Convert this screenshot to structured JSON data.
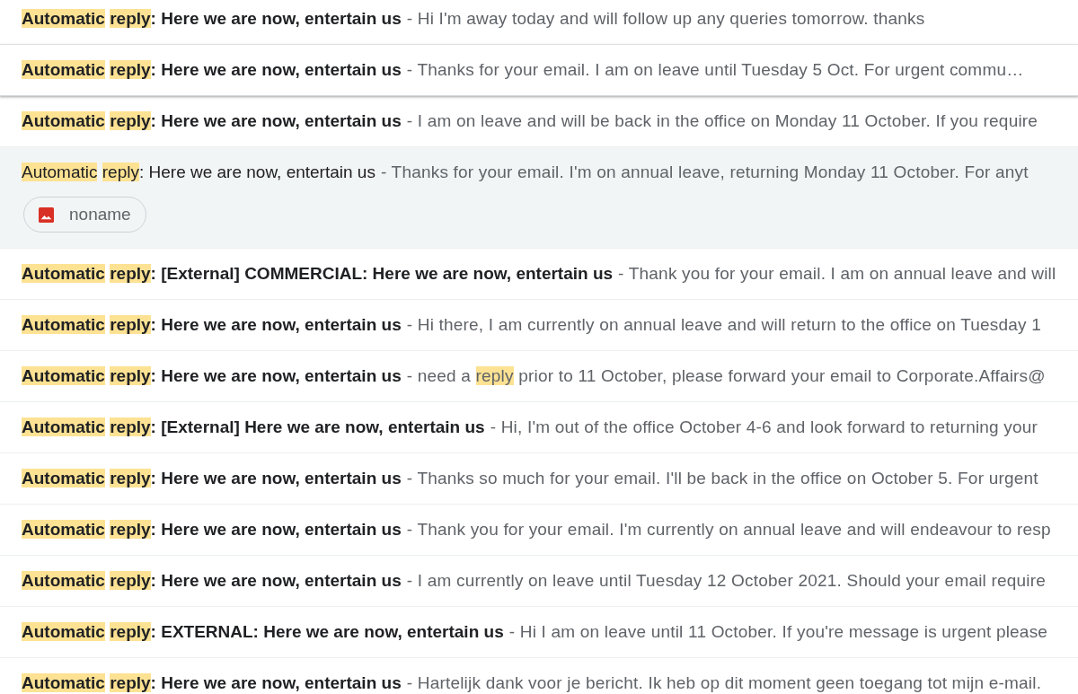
{
  "results": [
    {
      "unread": true,
      "hovered": false,
      "subject": [
        {
          "text": "Automatic ",
          "highlighted": true
        },
        {
          "text": "reply",
          "highlighted": true
        },
        {
          "text": ": Here we are now, entertain us",
          "highlighted": false
        }
      ],
      "snippet": [
        {
          "text": "- Hi I'm away today and will follow up any queries tomorrow. thanks",
          "highlighted": false
        }
      ]
    },
    {
      "unread": true,
      "hovered": true,
      "subject": [
        {
          "text": "Automatic ",
          "highlighted": true
        },
        {
          "text": "reply",
          "highlighted": true
        },
        {
          "text": ": Here we are now, entertain us",
          "highlighted": false
        }
      ],
      "snippet": [
        {
          "text": "- Thanks for your email. I am on leave until Tuesday 5 Oct. For urgent commu…",
          "highlighted": false
        }
      ]
    },
    {
      "unread": true,
      "hovered": false,
      "subject": [
        {
          "text": "Automatic ",
          "highlighted": true
        },
        {
          "text": "reply",
          "highlighted": true
        },
        {
          "text": ": Here we are now, entertain us",
          "highlighted": false
        }
      ],
      "snippet": [
        {
          "text": "- I am on leave and will be back in the office on Monday 11 October. If you require",
          "highlighted": false
        }
      ]
    },
    {
      "unread": false,
      "hovered": false,
      "subject": [
        {
          "text": "Automatic ",
          "highlighted": true
        },
        {
          "text": "reply",
          "highlighted": true
        },
        {
          "text": ": Here we are now, entertain us",
          "highlighted": false
        }
      ],
      "snippet": [
        {
          "text": "- Thanks for your email. I'm on annual leave, returning Monday 11 October. For anyt",
          "highlighted": false
        }
      ],
      "attachments": [
        {
          "name": "noname",
          "kind": "image"
        }
      ]
    },
    {
      "unread": true,
      "hovered": false,
      "subject": [
        {
          "text": "Automatic ",
          "highlighted": true
        },
        {
          "text": "reply",
          "highlighted": true
        },
        {
          "text": ": [External] COMMERCIAL: Here we are now, entertain us",
          "highlighted": false
        }
      ],
      "snippet": [
        {
          "text": "- Thank you for your email. I am on annual leave and will",
          "highlighted": false
        }
      ]
    },
    {
      "unread": true,
      "hovered": false,
      "subject": [
        {
          "text": "Automatic ",
          "highlighted": true
        },
        {
          "text": "reply",
          "highlighted": true
        },
        {
          "text": ": Here we are now, entertain us",
          "highlighted": false
        }
      ],
      "snippet": [
        {
          "text": "- Hi there, I am currently on annual leave and will return to the office on Tuesday 1",
          "highlighted": false
        }
      ]
    },
    {
      "unread": true,
      "hovered": false,
      "subject": [
        {
          "text": "Automatic ",
          "highlighted": true
        },
        {
          "text": "reply",
          "highlighted": true
        },
        {
          "text": ": Here we are now, entertain us",
          "highlighted": false
        }
      ],
      "snippet": [
        {
          "text": "- need a ",
          "highlighted": false
        },
        {
          "text": "reply",
          "highlighted": true
        },
        {
          "text": " prior to 11 October, please forward your email to Corporate.Affairs@",
          "highlighted": false
        }
      ]
    },
    {
      "unread": true,
      "hovered": false,
      "subject": [
        {
          "text": "Automatic ",
          "highlighted": true
        },
        {
          "text": "reply",
          "highlighted": true
        },
        {
          "text": ": [External] Here we are now, entertain us",
          "highlighted": false
        }
      ],
      "snippet": [
        {
          "text": "- Hi, I'm out of the office October 4-6 and look forward to returning your",
          "highlighted": false
        }
      ]
    },
    {
      "unread": true,
      "hovered": false,
      "subject": [
        {
          "text": "Automatic ",
          "highlighted": true
        },
        {
          "text": "reply",
          "highlighted": true
        },
        {
          "text": ": Here we are now, entertain us",
          "highlighted": false
        }
      ],
      "snippet": [
        {
          "text": "- Thanks so much for your email. I'll be back in the office on October 5. For urgent",
          "highlighted": false
        }
      ]
    },
    {
      "unread": true,
      "hovered": false,
      "subject": [
        {
          "text": "Automatic ",
          "highlighted": true
        },
        {
          "text": "reply",
          "highlighted": true
        },
        {
          "text": ": Here we are now, entertain us",
          "highlighted": false
        }
      ],
      "snippet": [
        {
          "text": "- Thank you for your email. I'm currently on annual leave and will endeavour to resp",
          "highlighted": false
        }
      ]
    },
    {
      "unread": true,
      "hovered": false,
      "subject": [
        {
          "text": "Automatic ",
          "highlighted": true
        },
        {
          "text": "reply",
          "highlighted": true
        },
        {
          "text": ": Here we are now, entertain us",
          "highlighted": false
        }
      ],
      "snippet": [
        {
          "text": "- I am currently on leave until Tuesday 12 October 2021. Should your email require",
          "highlighted": false
        }
      ]
    },
    {
      "unread": true,
      "hovered": false,
      "subject": [
        {
          "text": "Automatic ",
          "highlighted": true
        },
        {
          "text": "reply",
          "highlighted": true
        },
        {
          "text": ": EXTERNAL: Here we are now, entertain us",
          "highlighted": false
        }
      ],
      "snippet": [
        {
          "text": "- Hi I am on leave until 11 October. If you're message is urgent please",
          "highlighted": false
        }
      ]
    },
    {
      "unread": true,
      "hovered": false,
      "subject": [
        {
          "text": "Automatic ",
          "highlighted": true
        },
        {
          "text": "reply",
          "highlighted": true
        },
        {
          "text": ": Here we are now, entertain us",
          "highlighted": false
        }
      ],
      "snippet": [
        {
          "text": "- Hartelijk dank voor je bericht. Ik heb op dit moment geen toegang tot mijn e-mail.",
          "highlighted": false
        }
      ]
    }
  ]
}
